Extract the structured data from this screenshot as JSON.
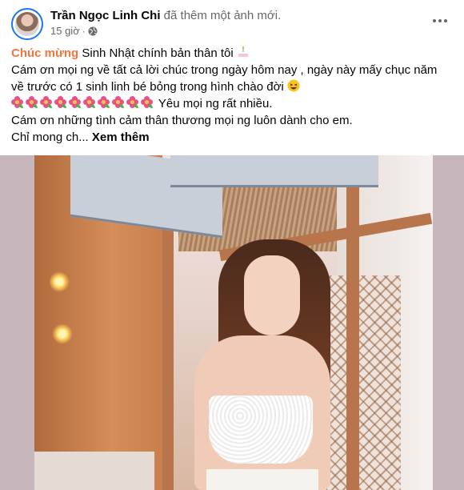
{
  "post": {
    "author_name": "Trần Ngọc Linh Chi",
    "author_action": "đã thêm một ảnh mới.",
    "timestamp": "15 giờ",
    "separator": "·",
    "privacy_icon": "globe-icon",
    "more_icon": "more-horizontal-icon"
  },
  "text": {
    "line1_highlight": "Chúc mừng",
    "line1_rest": " Sinh Nhật chính bản thân tôi ",
    "line1_emoji": "birthday-cake-emoji",
    "line2": "Cám ơn mọi ng về tất cả lời chúc trong ngày hôm nay , ngày này mấy chục năm",
    "line3": "về trước có 1 sinh linh bé bỏng trong hình chào đời ",
    "line3_emoji": "laughing-face-emoji",
    "flower_emoji": "blossom-emoji",
    "flower_count": 10,
    "line4_rest": " Yêu mọi ng rất nhiều.",
    "line5": "Cám ơn những tình cảm thân thương mọi ng luôn dành cho em.",
    "line6": "Chỉ mong ch... ",
    "see_more": "Xem thêm"
  },
  "colors": {
    "highlight": "#f6743b",
    "secondary_text": "#65676b",
    "avatar_ring": "#1877f2",
    "photo_frame": "#c8b6bd"
  },
  "photo": {
    "alt_subject": "woman in white lace top in wooden beach hut"
  }
}
